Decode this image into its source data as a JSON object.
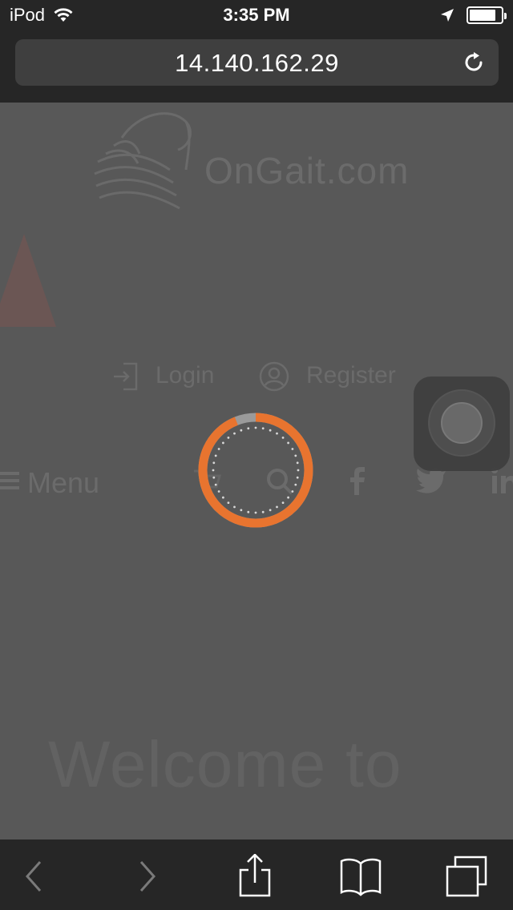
{
  "status_bar": {
    "carrier": "iPod",
    "time": "3:35 PM",
    "battery_level": 0.85
  },
  "browser": {
    "url": "14.140.162.29"
  },
  "page": {
    "logo_text": "OnGait.com",
    "login_label": "Login",
    "register_label": "Register",
    "menu_label": "Menu",
    "welcome_heading": "Welcome to"
  },
  "loading": {
    "accent_color": "#e8742f",
    "progress": 0.94
  },
  "colors": {
    "page_overlay": "#585858",
    "chrome_bg": "#262626",
    "url_field": "#3f3f3f"
  }
}
